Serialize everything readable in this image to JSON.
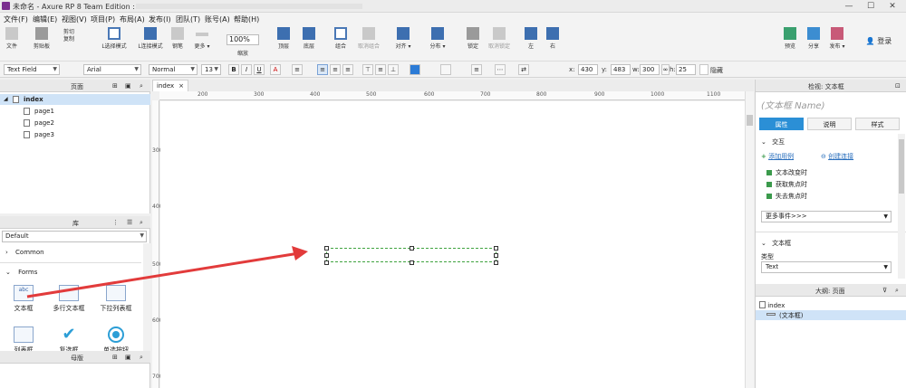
{
  "window": {
    "title": "未命名 - Axure RP 8 Team Edition : ",
    "min": "—",
    "max": "☐",
    "close": "✕"
  },
  "menu": [
    "文件(F)",
    "编辑(E)",
    "视图(V)",
    "项目(P)",
    "布局(A)",
    "发布(I)",
    "团队(T)",
    "账号(A)",
    "帮助(H)"
  ],
  "toolbar": {
    "file": "文件",
    "paste_board": "剪贴板",
    "cut": "剪切",
    "copy": "复制",
    "paste": "粘贴",
    "select_mode": "L选择模式",
    "connect_mode": "L连接模式",
    "pen": "钢笔",
    "more": "更多 ▾",
    "zoom": "100%",
    "zoom_label": "缩放",
    "top": "顶层",
    "bottom": "底层",
    "group": "组合",
    "ungroup": "取消组合",
    "align": "对齐 ▾",
    "distribute": "分布 ▾",
    "lock": "锁定",
    "unlock": "取消锁定",
    "left": "左",
    "right": "右",
    "preview": "预览",
    "share": "分享",
    "publish": "发布 ▾",
    "login": "登录"
  },
  "format": {
    "widget_type": "Text Field",
    "font": "Arial",
    "style": "Normal",
    "size": "13",
    "x_label": "x:",
    "x": "430",
    "y_label": "y:",
    "y": "483",
    "w_label": "w:",
    "w": "300",
    "h_label": "h:",
    "h": "25",
    "hidden": "隐藏"
  },
  "pages": {
    "title": "页面",
    "items": [
      "index",
      "page1",
      "page2",
      "page3"
    ]
  },
  "library": {
    "title": "库",
    "selected": "Default",
    "section_common": "Common",
    "section_forms": "Forms",
    "items": [
      "文本框",
      "多行文本框",
      "下拉列表框",
      "列表框",
      "复选框",
      "单选按钮"
    ]
  },
  "masters": {
    "title": "母版"
  },
  "canvas": {
    "tab": "index",
    "ruler_top": [
      "200",
      "300",
      "400",
      "500",
      "600",
      "700",
      "800",
      "900",
      "1000",
      "1100"
    ],
    "ruler_left": [
      "300",
      "400",
      "500",
      "600",
      "700"
    ]
  },
  "inspector": {
    "title": "检视: 文本框",
    "name_placeholder": "(文本框 Name)",
    "tabs": [
      "属性",
      "说明",
      "样式"
    ],
    "interaction_title": "交互",
    "add_case": "添加用例",
    "create_link": "创建连接",
    "events": [
      "文本改变时",
      "获取焦点时",
      "失去焦点时"
    ],
    "more_events": "更多事件>>>",
    "textfield_title": "文本框",
    "type_label": "类型",
    "type_value": "Text"
  },
  "outline": {
    "title": "大纲: 页面",
    "root": "index",
    "child": "(文本框)"
  },
  "colors": {
    "accent": "#2b8fd6",
    "arrow": "#e23b3b",
    "selection": "#3fa33f"
  }
}
